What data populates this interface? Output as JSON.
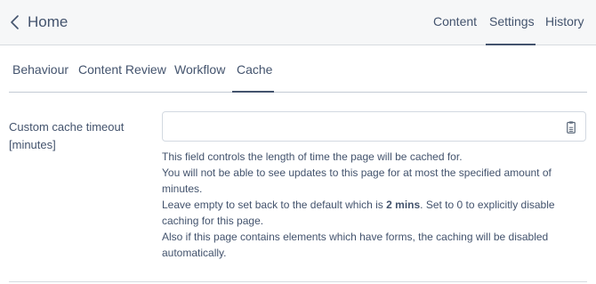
{
  "header": {
    "title": "Home",
    "tabs": [
      {
        "label": "Content",
        "active": false
      },
      {
        "label": "Settings",
        "active": true
      },
      {
        "label": "History",
        "active": false
      }
    ]
  },
  "sub_tabs": [
    {
      "label": "Behaviour",
      "active": false
    },
    {
      "label": "Content Review",
      "active": false
    },
    {
      "label": "Workflow",
      "active": false
    },
    {
      "label": "Cache",
      "active": true
    }
  ],
  "field": {
    "label": "Custom cache timeout [minutes]",
    "value": "",
    "placeholder": "",
    "icon": "clipboard-icon"
  },
  "help": {
    "line1": "This field controls the length of time the page will be cached for.",
    "line2": "You will not be able to see updates to this page for at most the specified amount of minutes.",
    "line3_pre": "Leave empty to set back to the default which is ",
    "line3_bold": "2 mins",
    "line3_post": ". Set to 0 to explicitly disable caching for this page.",
    "line4": "Also if this page contains elements which have forms, the caching will be disabled automatically."
  },
  "colors": {
    "text": "#43536d",
    "header_bg": "#f6f7f8",
    "border": "#d7dbe0"
  }
}
